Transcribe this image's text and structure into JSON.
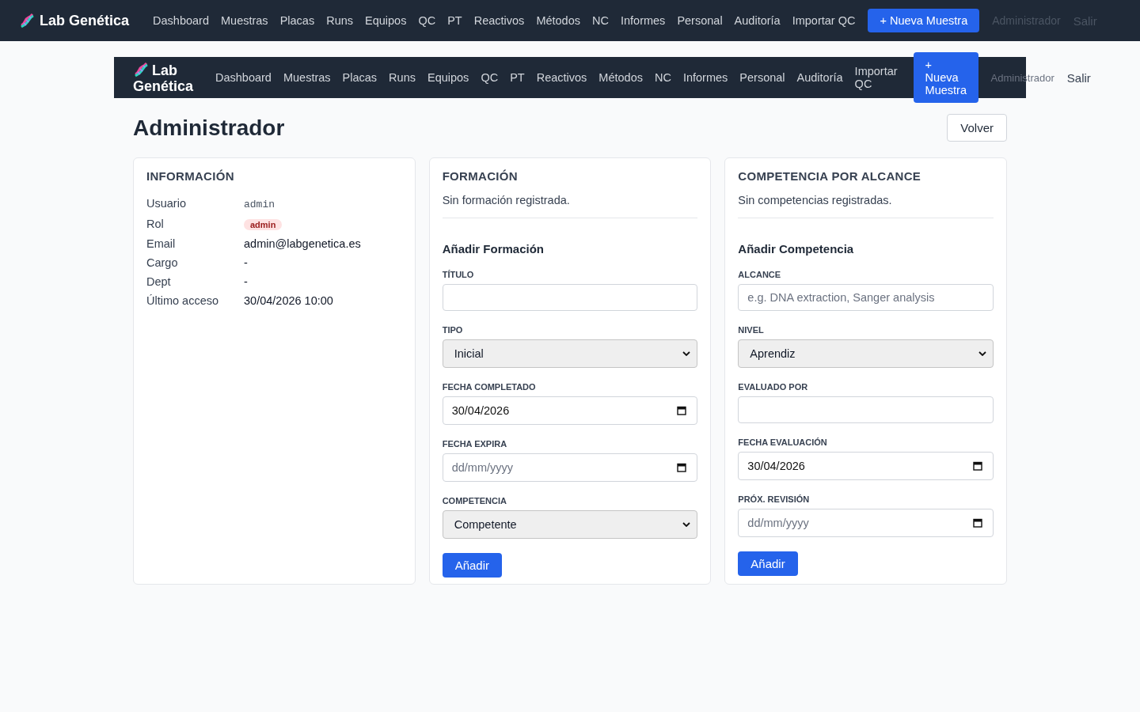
{
  "top_nav": {
    "brand": "Lab Genética",
    "links": [
      "Dashboard",
      "Muestras",
      "Placas",
      "Runs",
      "Equipos",
      "QC",
      "PT",
      "Reactivos",
      "Métodos",
      "NC",
      "Informes",
      "Personal",
      "Auditoría",
      "Importar QC"
    ],
    "action_button": "+ Nueva Muestra",
    "user": "Administrador",
    "logout": "Salir"
  },
  "inner_nav": {
    "brand": "Lab Genética",
    "links": [
      "Dashboard",
      "Muestras",
      "Placas",
      "Runs",
      "Equipos",
      "QC",
      "PT",
      "Reactivos",
      "Métodos",
      "NC",
      "Informes",
      "Personal",
      "Auditoría",
      "Importar QC"
    ],
    "action_button": "+ Nueva Muestra",
    "user": "Administrador",
    "logout": "Salir"
  },
  "page_title": "Administrador",
  "back_button": "Volver",
  "info_card": {
    "title": "INFORMACIÓN",
    "rows": [
      {
        "label": "Usuario",
        "value": "admin",
        "kind": "mono"
      },
      {
        "label": "Rol",
        "value": "admin",
        "kind": "badge"
      },
      {
        "label": "Email",
        "value": "admin@labgenetica.es",
        "kind": "text"
      },
      {
        "label": "Cargo",
        "value": "-",
        "kind": "text"
      },
      {
        "label": "Dept",
        "value": "-",
        "kind": "text"
      },
      {
        "label": "Último acceso",
        "value": "30/04/2026 10:00",
        "kind": "text"
      }
    ]
  },
  "form_cards": [
    {
      "title": "FORMACIÓN",
      "empty_text": "Sin formación registrada.",
      "form_title": "Añadir Formación",
      "fields": [
        {
          "label": "TÍTULO",
          "kind": "text"
        },
        {
          "label": "TIPO",
          "kind": "select",
          "value": "Inicial"
        },
        {
          "label": "FECHA COMPLETADO",
          "kind": "date",
          "value": "30/04/2026"
        },
        {
          "label": "FECHA EXPIRA",
          "kind": "date",
          "placeholder": "dd/mm/yyyy"
        },
        {
          "label": "COMPETENCIA",
          "kind": "select",
          "value": "Competente"
        }
      ],
      "submit": "Añadir"
    },
    {
      "title": "COMPETENCIA POR ALCANCE",
      "empty_text": "Sin competencias registradas.",
      "form_title": "Añadir Competencia",
      "fields": [
        {
          "label": "ALCANCE",
          "kind": "text",
          "placeholder": "e.g. DNA extraction, Sanger analysis"
        },
        {
          "label": "NIVEL",
          "kind": "select",
          "value": "Aprendiz"
        },
        {
          "label": "EVALUADO POR",
          "kind": "text"
        },
        {
          "label": "FECHA EVALUACIÓN",
          "kind": "date",
          "value": "30/04/2026"
        },
        {
          "label": "PRÓX. REVISIÓN",
          "kind": "date",
          "placeholder": "dd/mm/yyyy"
        }
      ],
      "submit": "Añadir"
    }
  ]
}
